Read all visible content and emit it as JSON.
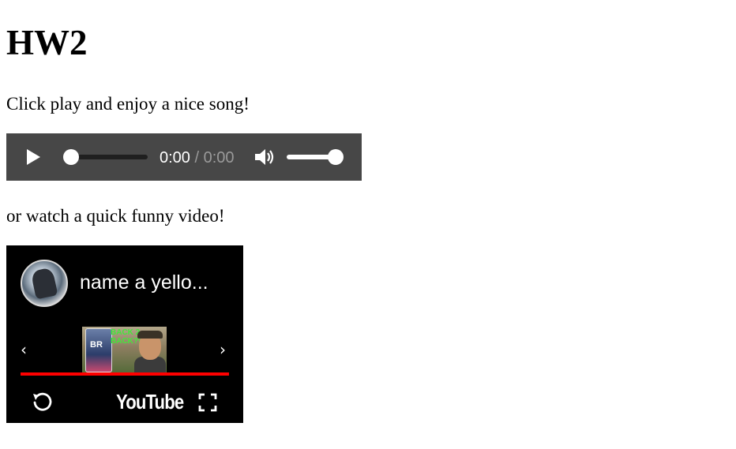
{
  "page": {
    "heading": "HW2",
    "intro_text": "Click play and enjoy a nice song!",
    "video_intro_text": "or watch a quick funny video!"
  },
  "audio_player": {
    "current_time": "0:00",
    "separator": " / ",
    "duration": "0:00",
    "progress_fraction": 0,
    "volume_fraction": 1,
    "icons": [
      "play-icon",
      "volume-icon"
    ]
  },
  "video_embed": {
    "title": "name a yello...",
    "thumbnail_text": "BACK 2\nBACK?!",
    "thumbnail_card_text": "BR",
    "logo_text": "YouTube",
    "progress_fraction": 1,
    "prev_glyph": "‹",
    "next_glyph": "›",
    "icons": [
      "channel-avatar",
      "chevron-left-icon",
      "chevron-right-icon",
      "replay-icon",
      "youtube-logo",
      "fullscreen-icon"
    ],
    "accent_color": "#ff0000"
  }
}
